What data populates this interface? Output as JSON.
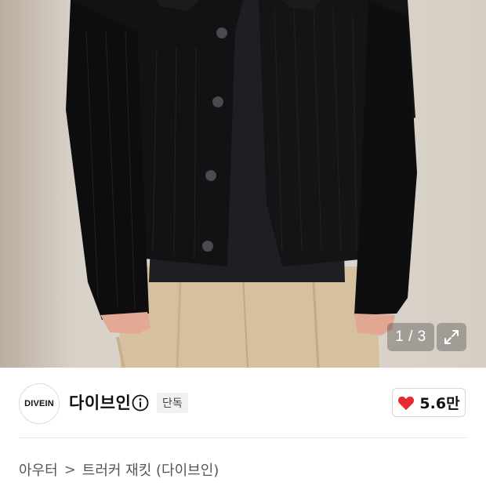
{
  "gallery": {
    "counter": "1 / 3"
  },
  "brand": {
    "logo_text": "DIVEIN",
    "name": "다이브인",
    "exclusive_label": "단독",
    "like_count": "5.6만",
    "heart_color": "#e8292f"
  },
  "breadcrumb": {
    "category": "아우터",
    "separator": ">",
    "product": "트러커 재킷 (다이브인)"
  },
  "icons": {
    "info": "info-icon",
    "expand": "expand-icon",
    "heart": "heart-icon",
    "chevron": "chevron-right-icon"
  }
}
